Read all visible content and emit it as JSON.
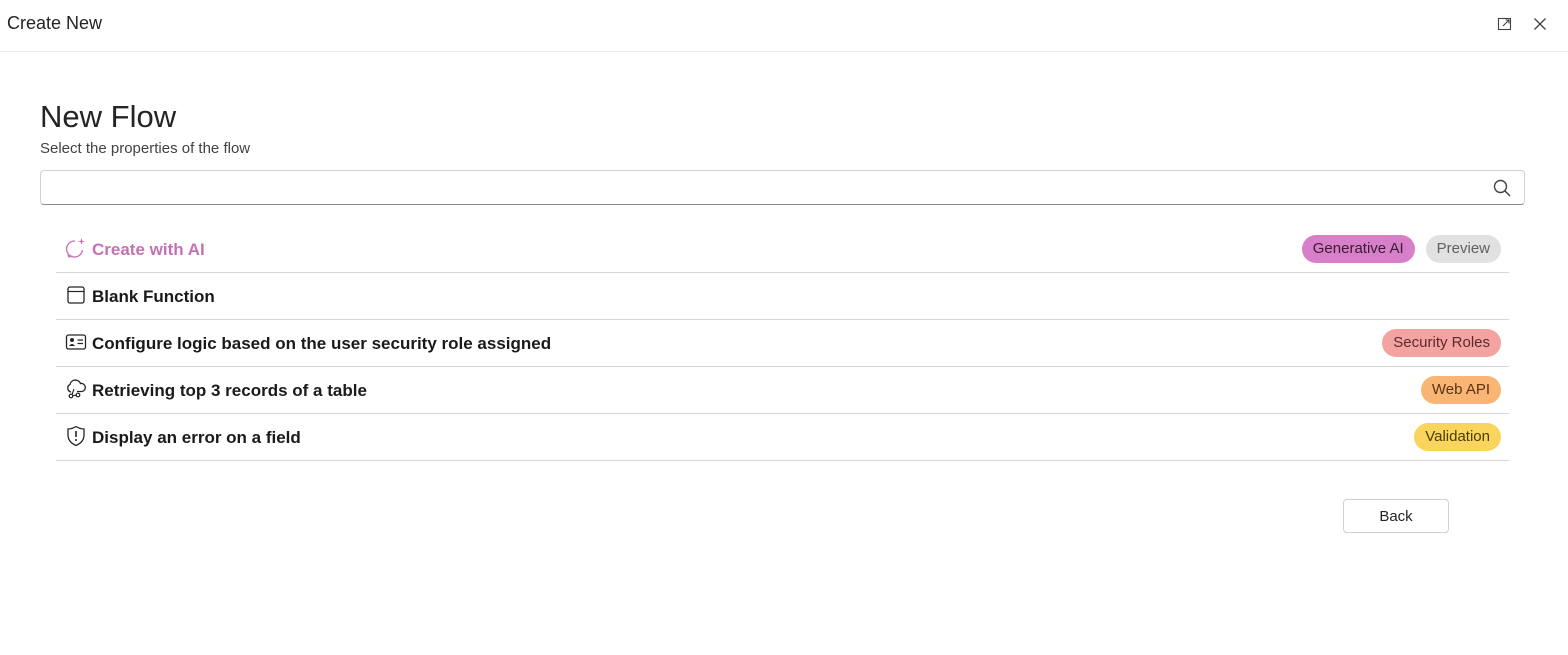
{
  "dialog": {
    "title": "Create New"
  },
  "header": {
    "title": "New Flow",
    "subtitle": "Select the properties of the flow"
  },
  "search": {
    "value": "",
    "placeholder": ""
  },
  "items": [
    {
      "label": "Create with AI",
      "icon": "sparkle-chat-icon",
      "badges": [
        {
          "text": "Generative AI",
          "bg": "#d77fc9",
          "fg": "#3b1b36"
        },
        {
          "text": "Preview",
          "bg": "#e1e1e1",
          "fg": "#616161"
        }
      ]
    },
    {
      "label": "Blank Function",
      "icon": "window-icon",
      "badges": []
    },
    {
      "label": "Configure logic based on the user security role assigned",
      "icon": "contact-card-icon",
      "badges": [
        {
          "text": "Security Roles",
          "bg": "#f4a3a3",
          "fg": "#5c2a2a"
        }
      ]
    },
    {
      "label": "Retrieving top 3 records of a table",
      "icon": "cloud-link-icon",
      "badges": [
        {
          "text": "Web API",
          "bg": "#f9b574",
          "fg": "#5a3311"
        }
      ]
    },
    {
      "label": "Display an error on a field",
      "icon": "shield-error-icon",
      "badges": [
        {
          "text": "Validation",
          "bg": "#f9d55e",
          "fg": "#4d3c00"
        }
      ]
    }
  ],
  "footer": {
    "back_label": "Back"
  },
  "colors": {
    "ai_accent": "#c471b6"
  }
}
